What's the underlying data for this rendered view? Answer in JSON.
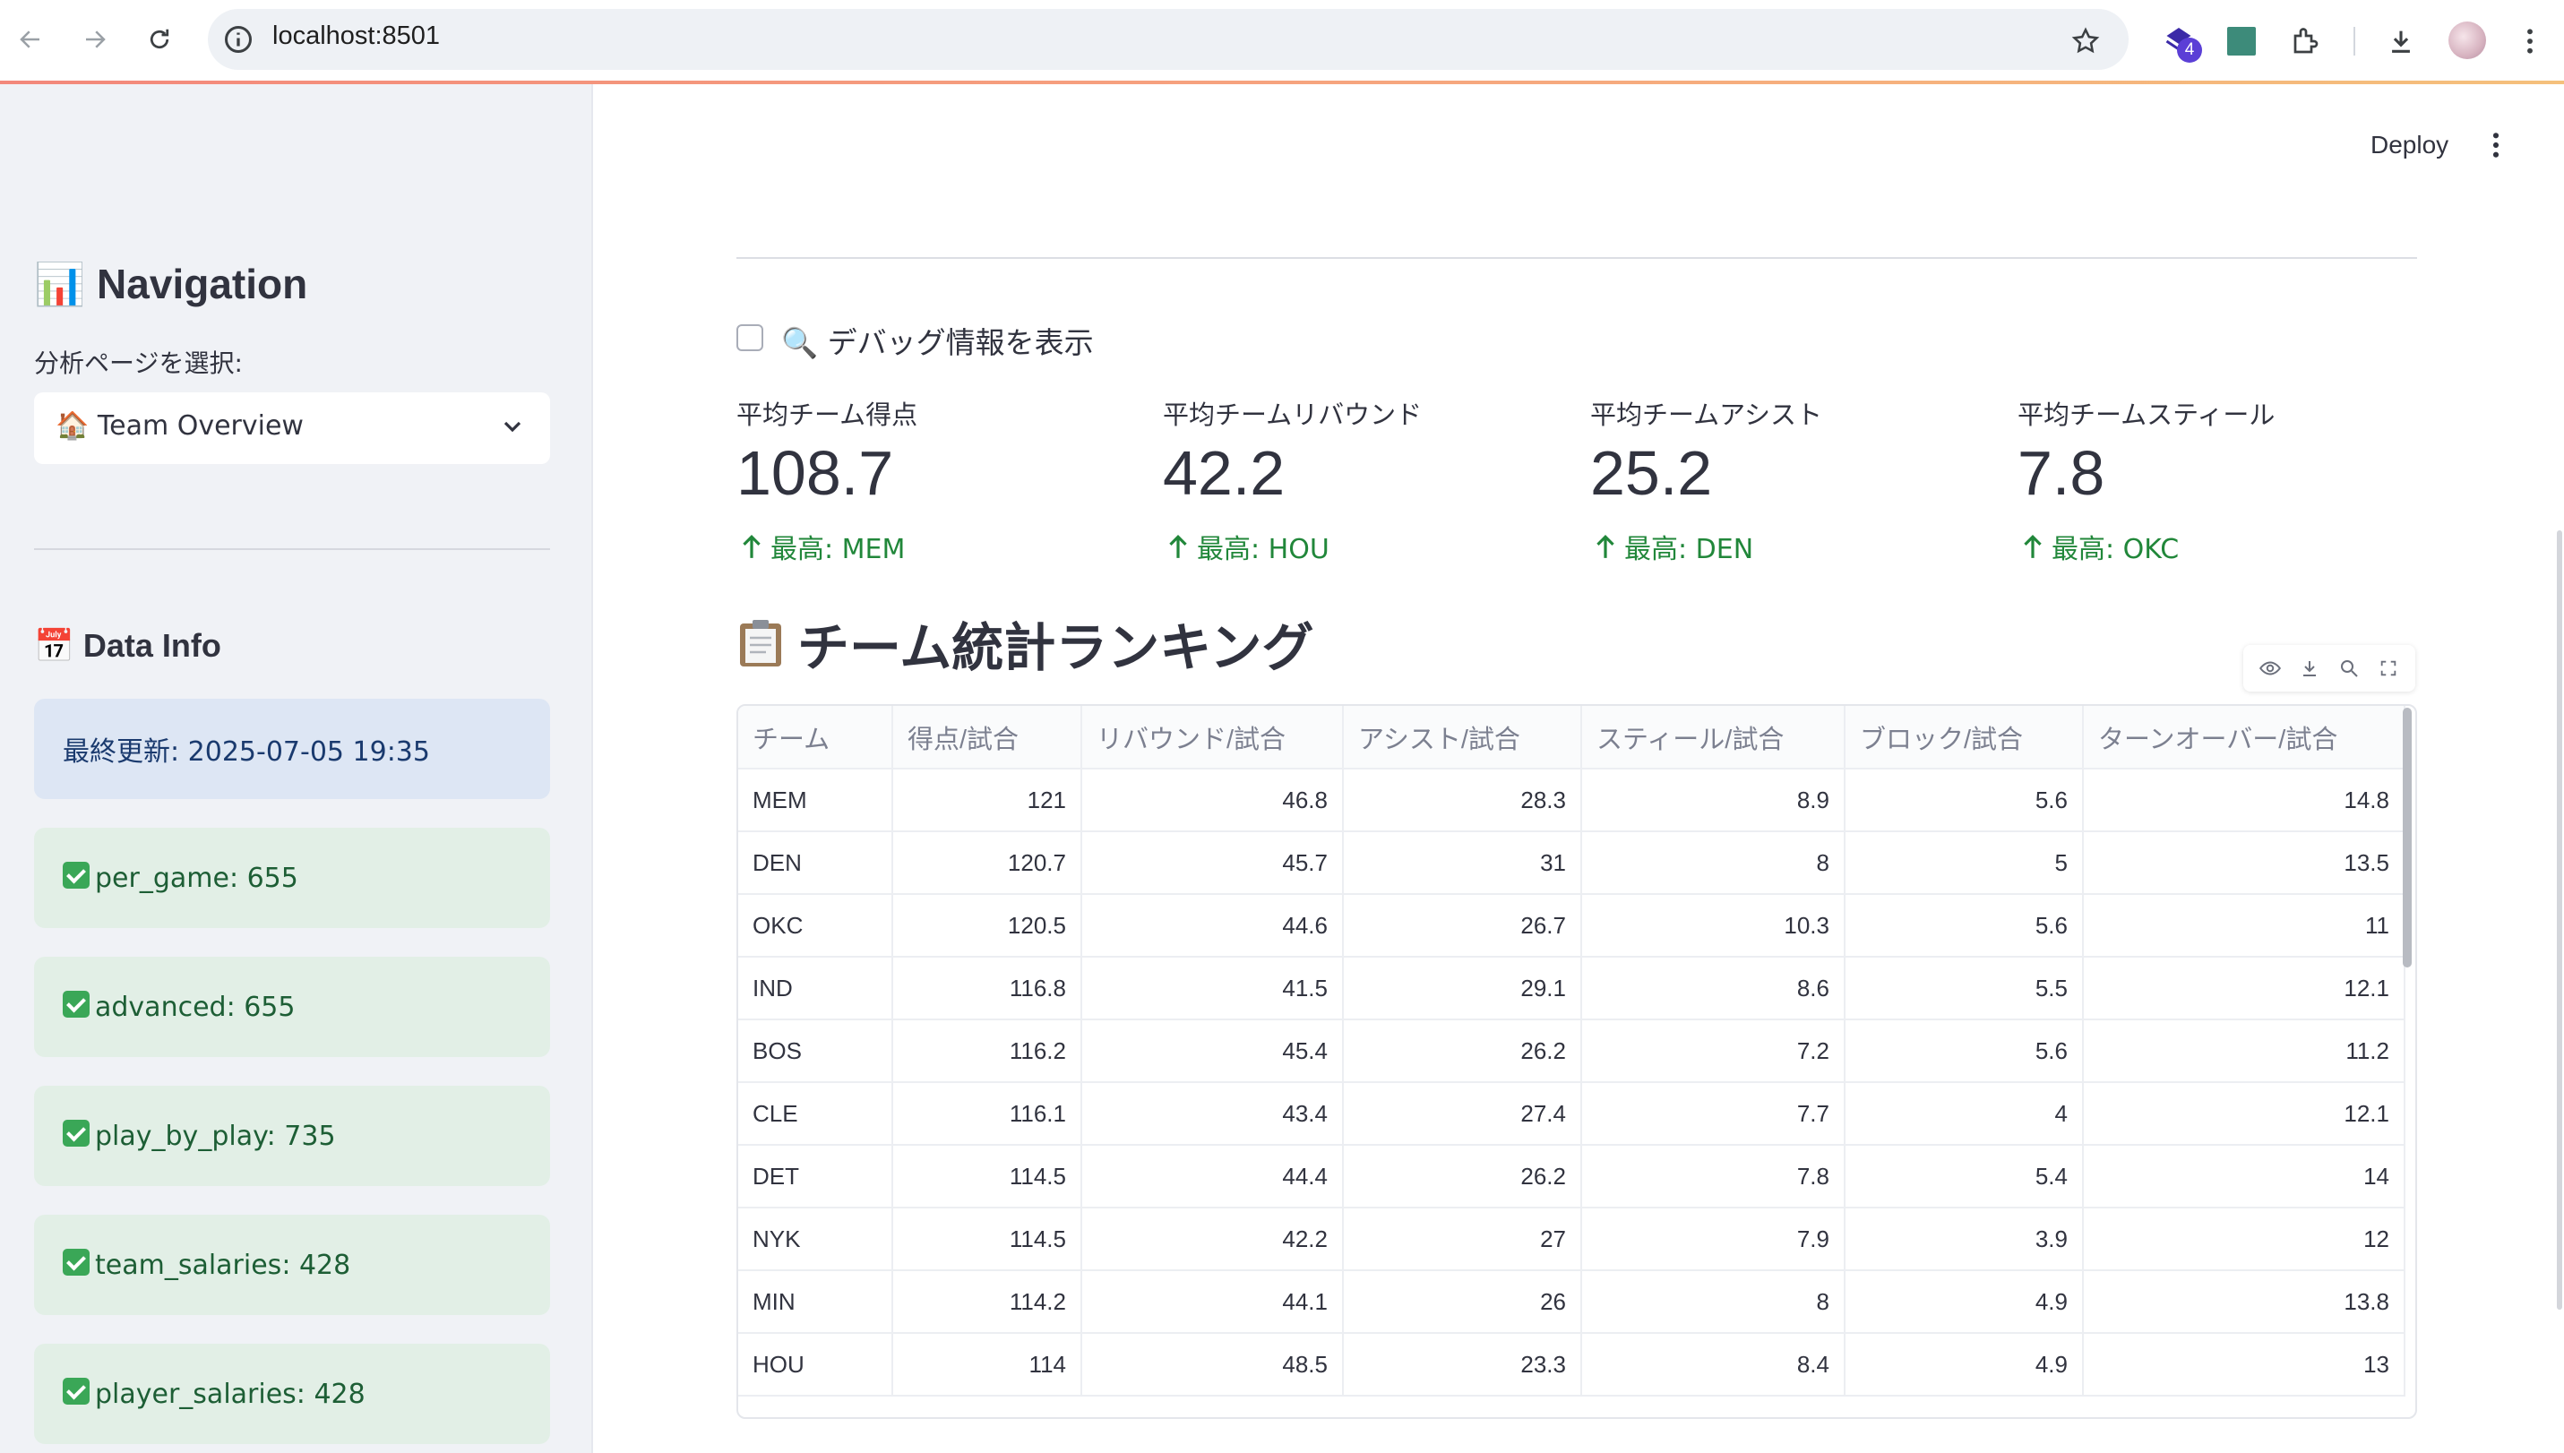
{
  "browser": {
    "url": "localhost:8501",
    "extension_badge": "4"
  },
  "sidebar": {
    "nav_title": "📊 Navigation",
    "select_label": "分析ページを選択:",
    "select_value": "🏠 Team Overview",
    "data_info_title": "📅 Data Info",
    "last_updated": "最終更新: 2025-07-05 19:35",
    "datasets": [
      {
        "label": "per_game: 655"
      },
      {
        "label": "advanced: 655"
      },
      {
        "label": "play_by_play: 735"
      },
      {
        "label": "team_salaries: 428"
      },
      {
        "label": "player_salaries: 428"
      }
    ]
  },
  "header": {
    "deploy_label": "Deploy"
  },
  "debug": {
    "label": "🔍 デバッグ情報を表示",
    "checked": false
  },
  "metrics": [
    {
      "label": "平均チーム得点",
      "value": "108.7",
      "delta": "最高: MEM"
    },
    {
      "label": "平均チームリバウンド",
      "value": "42.2",
      "delta": "最高: HOU"
    },
    {
      "label": "平均チームアシスト",
      "value": "25.2",
      "delta": "最高: DEN"
    },
    {
      "label": "平均チームスティール",
      "value": "7.8",
      "delta": "最高: OKC"
    }
  ],
  "section": {
    "title": "チーム統計ランキング"
  },
  "table": {
    "columns": [
      "チーム",
      "得点/試合",
      "リバウンド/試合",
      "アシスト/試合",
      "スティール/試合",
      "ブロック/試合",
      "ターンオーバー/試合"
    ],
    "rows": [
      [
        "MEM",
        "121",
        "46.8",
        "28.3",
        "8.9",
        "5.6",
        "14.8"
      ],
      [
        "DEN",
        "120.7",
        "45.7",
        "31",
        "8",
        "5",
        "13.5"
      ],
      [
        "OKC",
        "120.5",
        "44.6",
        "26.7",
        "10.3",
        "5.6",
        "11"
      ],
      [
        "IND",
        "116.8",
        "41.5",
        "29.1",
        "8.6",
        "5.5",
        "12.1"
      ],
      [
        "BOS",
        "116.2",
        "45.4",
        "26.2",
        "7.2",
        "5.6",
        "11.2"
      ],
      [
        "CLE",
        "116.1",
        "43.4",
        "27.4",
        "7.7",
        "4",
        "12.1"
      ],
      [
        "DET",
        "114.5",
        "44.4",
        "26.2",
        "7.8",
        "5.4",
        "14"
      ],
      [
        "NYK",
        "114.5",
        "42.2",
        "27",
        "7.9",
        "3.9",
        "12"
      ],
      [
        "MIN",
        "114.2",
        "44.1",
        "26",
        "8",
        "4.9",
        "13.8"
      ],
      [
        "HOU",
        "114",
        "48.5",
        "23.3",
        "8.4",
        "4.9",
        "13"
      ]
    ]
  },
  "colors": {
    "accent_green": "#21873a",
    "sidebar_bg": "#f0f2f6",
    "info_blue": "#dde6f4",
    "info_green": "#e2efe6"
  }
}
